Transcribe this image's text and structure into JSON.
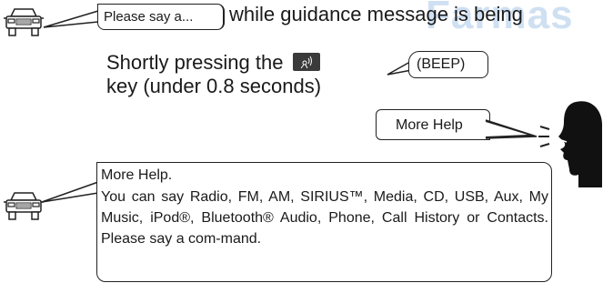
{
  "watermark": "Farmas",
  "prompt": {
    "bubble_label": "Please say a...",
    "trailing_text": "while guidance message is being"
  },
  "instruction": {
    "line1_prefix": "Shortly pressing the",
    "line2": "key (under 0.8 seconds)",
    "key_icon": "voice-command-key-icon"
  },
  "beep": "(BEEP)",
  "user_speech": "More Help",
  "response": {
    "title": "More Help.",
    "body": "You can say Radio, FM, AM, SIRIUS™, Media, CD, USB, Aux, My Music, iPod®, Bluetooth® Audio, Phone, Call History or Contacts. Please say a com-mand."
  },
  "colors": {
    "bubble_border": "#222222",
    "key_fill": "#3a3a3a",
    "watermark": "#cfe0f2"
  }
}
